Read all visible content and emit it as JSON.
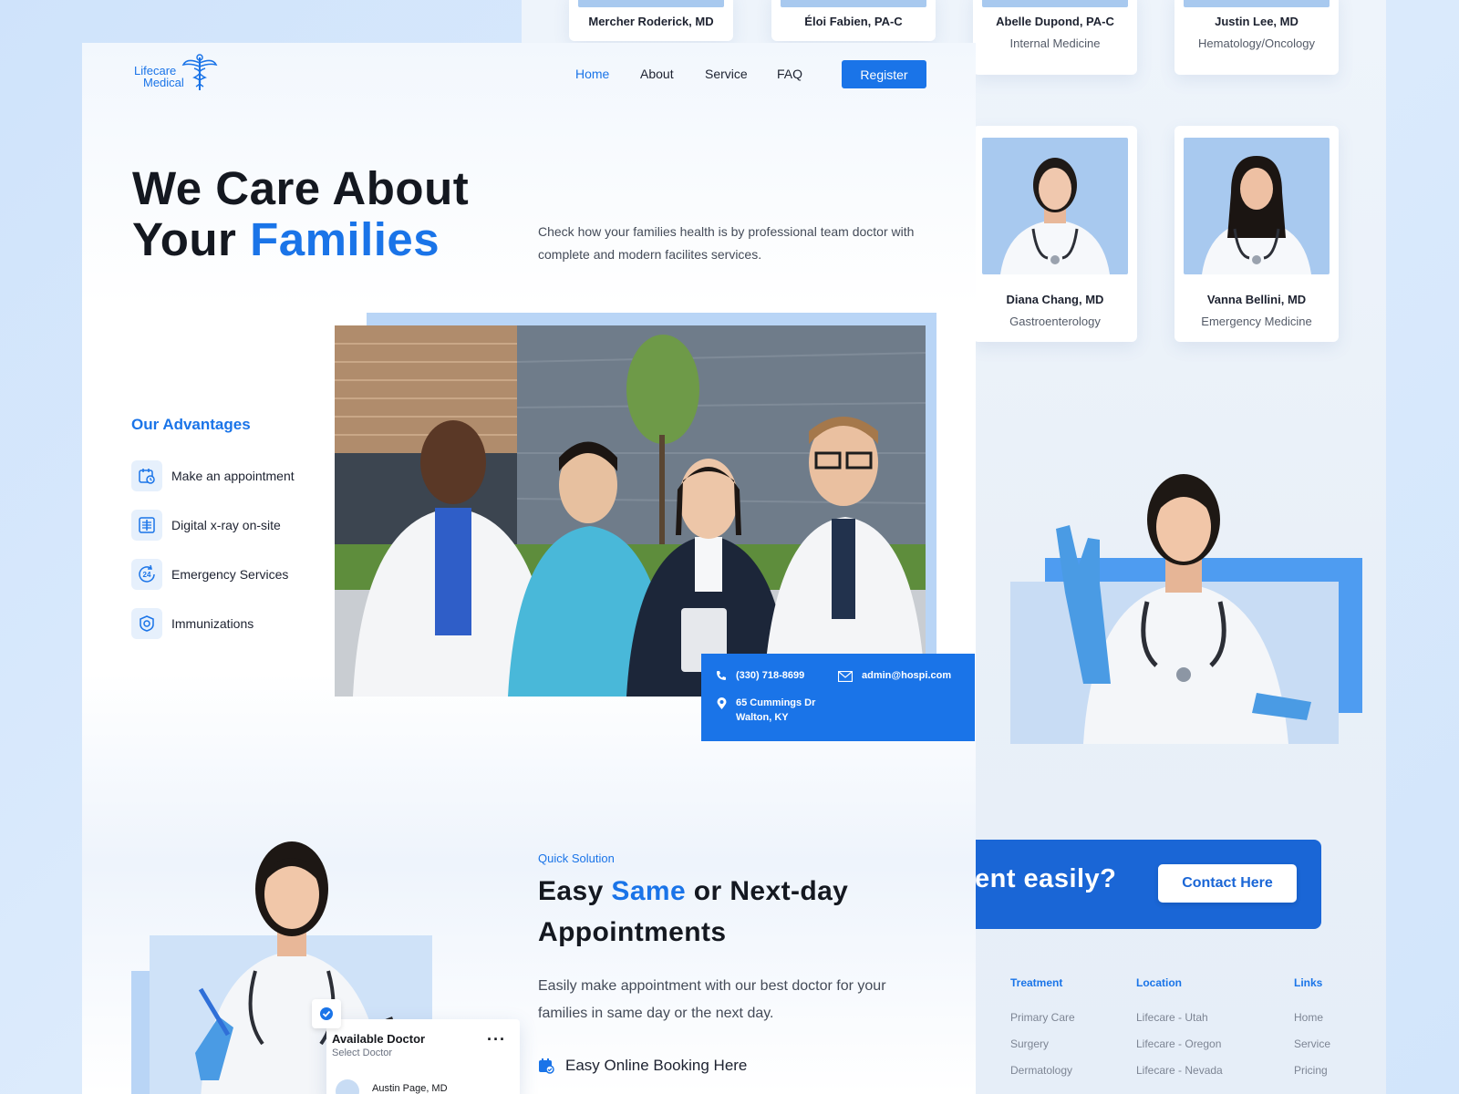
{
  "brand": {
    "line1": "Lifecare",
    "line2": "Medical"
  },
  "nav": {
    "home": "Home",
    "about": "About",
    "service": "Service",
    "faq": "FAQ",
    "register": "Register"
  },
  "hero": {
    "title_part1": "We Care About",
    "title_part2": "Your ",
    "title_accent": "Families",
    "description": "Check how your families health is by professional team doctor with complete and modern facilites services."
  },
  "advantages": {
    "title": "Our Advantages",
    "items": [
      {
        "label": "Make an appointment",
        "icon": "calendar-clock-icon"
      },
      {
        "label": "Digital x-ray on-site",
        "icon": "xray-icon"
      },
      {
        "label": "Emergency Services",
        "icon": "24-hours-icon"
      },
      {
        "label": "Immunizations",
        "icon": "shield-vaccine-icon"
      }
    ]
  },
  "contact": {
    "phone": "(330) 718-8699",
    "email": "admin@hospi.com",
    "address_line1": "65 Cummings Dr",
    "address_line2": "Walton, KY"
  },
  "quick_solution": {
    "label": "Quick Solution",
    "title_part1": "Easy ",
    "title_accent": "Same",
    "title_part2": " or Next-day",
    "title_line2": "Appointments",
    "description": "Easily make appointment with our best doctor for your families in same day or the next day.",
    "booking_label": "Easy Online Booking Here"
  },
  "available_doctor": {
    "title": "Available Doctor",
    "subtitle": "Select Doctor",
    "preview_name": "Austin Page, MD"
  },
  "doctors_top": [
    {
      "name": "Mercher Roderick, MD",
      "specialty": ""
    },
    {
      "name": "Éloi Fabien, PA-C",
      "specialty": ""
    },
    {
      "name": "Abelle Dupond, PA-C",
      "specialty": "Internal Medicine"
    },
    {
      "name": "Justin Lee, MD",
      "specialty": "Hematology/Oncology"
    }
  ],
  "doctors_bottom": [
    {
      "name": "Diana Chang, MD",
      "specialty": "Gastroenterology"
    },
    {
      "name": "Vanna Bellini, MD",
      "specialty": "Emergency Medicine"
    }
  ],
  "cta": {
    "text": "ent easily?",
    "button": "Contact Here"
  },
  "footer": {
    "treatment": {
      "title": "Treatment",
      "links": [
        "Primary Care",
        "Surgery",
        "Dermatology"
      ]
    },
    "location": {
      "title": "Location",
      "links": [
        "Lifecare - Utah",
        "Lifecare - Oregon",
        "Lifecare - Nevada"
      ]
    },
    "links": {
      "title": "Links",
      "links": [
        "Home",
        "Service",
        "Pricing"
      ]
    }
  },
  "colors": {
    "accent": "#1a74e8",
    "accent_dark": "#1a66d6",
    "photo_bg": "#a8c9ef",
    "background": "#d4e6fb"
  }
}
